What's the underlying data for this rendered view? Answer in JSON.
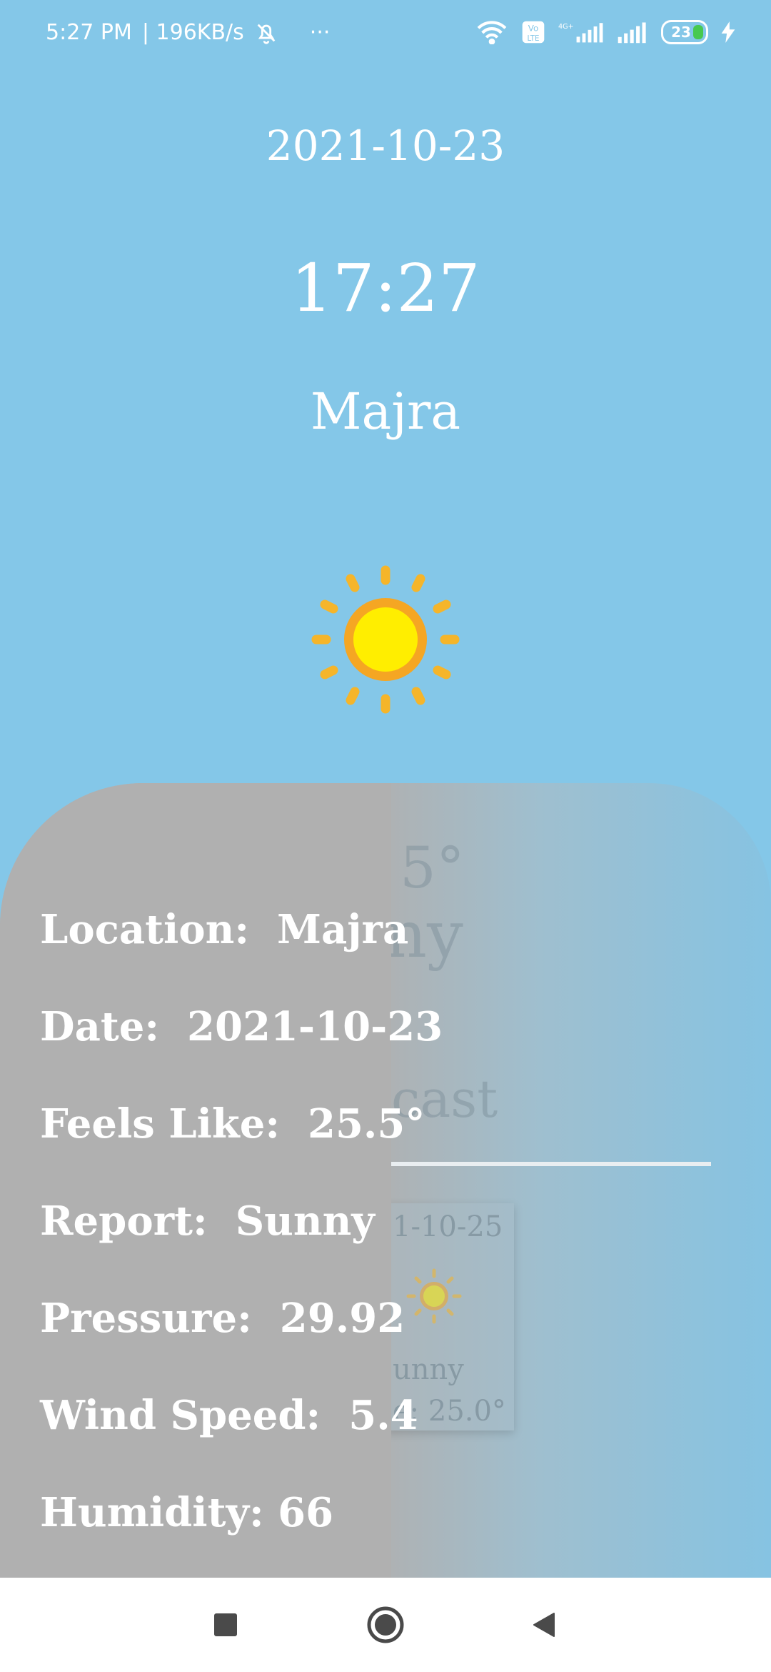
{
  "status_bar": {
    "time": "5:27 PM",
    "speed": "| 196KB/s",
    "more": "···",
    "battery": "23"
  },
  "header": {
    "date": "2021-10-23",
    "time": "17:27",
    "city": "Majra"
  },
  "weather_icon": "sun-icon",
  "background_card": {
    "temp_partial": "5°",
    "report_partial": "ny",
    "forecast_partial": "cast",
    "forecast_item": {
      "date": "1-10-25",
      "report": "unny",
      "temp": "e: 25.0°"
    }
  },
  "details": [
    {
      "label": "Location:  Majra"
    },
    {
      "label": "Date:  2021-10-23"
    },
    {
      "label": "Feels Like:  25.5°"
    },
    {
      "label": "Report:  Sunny"
    },
    {
      "label": "Pressure:  29.92"
    },
    {
      "label": "Wind Speed:  5.4"
    },
    {
      "label": "Humidity: 66"
    }
  ],
  "nav": {
    "recent": "square-icon",
    "home": "circle-icon",
    "back": "triangle-icon"
  },
  "colors": {
    "sky": "#84c7e8",
    "panel": "#b0b0b0",
    "sun_core": "#ffee00",
    "sun_ray": "#f5b52a"
  }
}
